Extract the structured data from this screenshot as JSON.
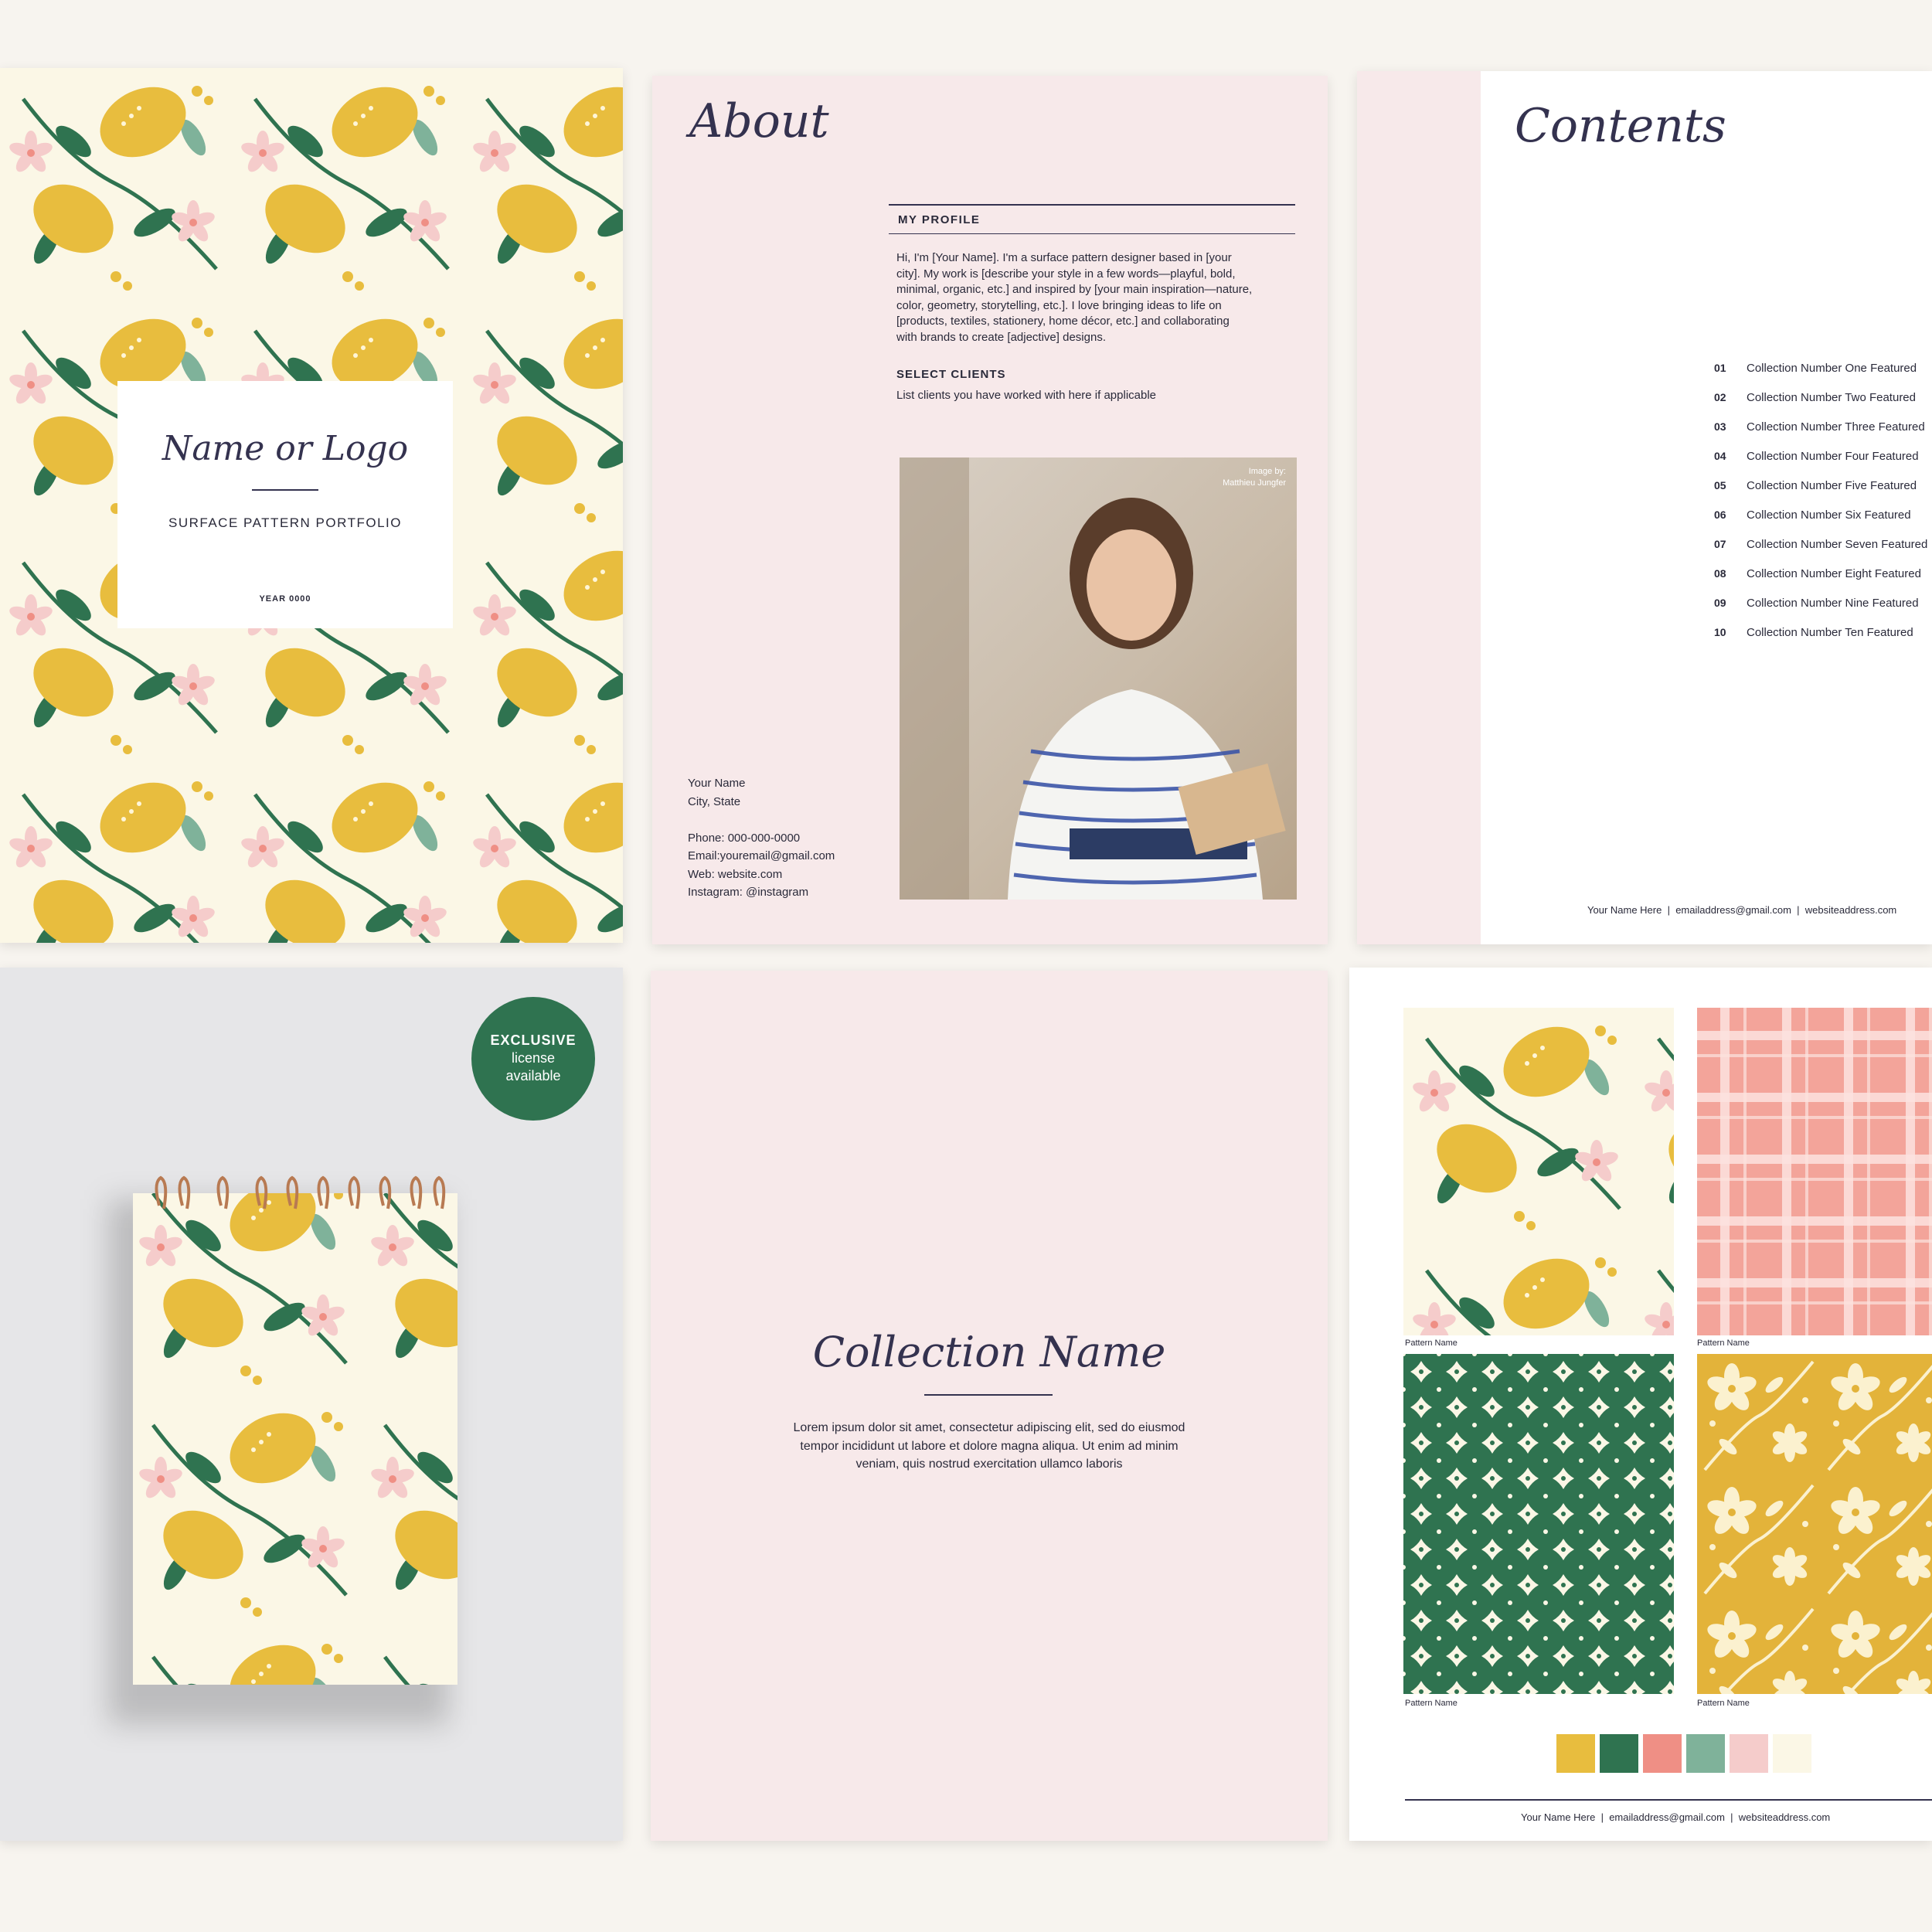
{
  "colors": {
    "background": "#f7f4ef",
    "cream": "#fbf7e6",
    "lemon": "#e8bd3e",
    "green": "#2f7350",
    "coral": "#ef8f85",
    "sage": "#7fb29a",
    "blush": "#f5cccb",
    "pink_page": "#f7e9ea",
    "navy": "#34324f"
  },
  "cover": {
    "title": "Name or Logo",
    "subtitle": "SURFACE PATTERN PORTFOLIO",
    "year": "YEAR 0000"
  },
  "about": {
    "heading": "About",
    "profile_heading": "MY PROFILE",
    "profile_lines": [
      "Hi, I'm [Your Name].  I'm a surface pattern designer based in [your",
      "city]. My work is [describe your style in a few words—playful, bold,",
      "minimal, organic, etc.] and inspired by [your main inspiration—nature,",
      "color, geometry, storytelling, etc.]. I love bringing ideas to life on",
      "[products, textiles, stationery, home décor, etc.] and collaborating",
      "with brands to create [adjective] designs."
    ],
    "clients_heading": "SELECT CLIENTS",
    "clients_text": "List clients you have worked with here if applicable",
    "image_credit_1": "Image by:",
    "image_credit_2": "Matthieu Jungfer",
    "contact": {
      "name": "Your Name",
      "city": "City, State",
      "phone": "Phone: 000-000-0000",
      "email": "Email:youremail@gmail.com",
      "web": "Web: website.com",
      "instagram": "Instagram: @instagram"
    }
  },
  "contents": {
    "heading": "Contents",
    "items": [
      {
        "num": "01",
        "label": "Collection Number One Featured"
      },
      {
        "num": "02",
        "label": "Collection Number Two Featured"
      },
      {
        "num": "03",
        "label": "Collection Number Three Featured"
      },
      {
        "num": "04",
        "label": "Collection Number Four Featured"
      },
      {
        "num": "05",
        "label": "Collection Number Five Featured"
      },
      {
        "num": "06",
        "label": "Collection Number Six Featured"
      },
      {
        "num": "07",
        "label": "Collection Number Seven Featured"
      },
      {
        "num": "08",
        "label": "Collection Number Eight Featured"
      },
      {
        "num": "09",
        "label": "Collection Number Nine Featured"
      },
      {
        "num": "10",
        "label": "Collection Number Ten Featured"
      }
    ],
    "footer": {
      "name": "Your Name Here",
      "email": "emailaddress@gmail.com",
      "web": "websiteaddress.com"
    }
  },
  "mockup": {
    "badge_line1": "EXCLUSIVE",
    "badge_line2": "license",
    "badge_line3": "available"
  },
  "collection": {
    "title": "Collection Name",
    "desc_lines": [
      "Lorem ipsum dolor sit amet, consectetur adipiscing elit, sed do eiusmod",
      "tempor incididunt ut labore et dolore magna aliqua. Ut enim ad minim",
      "veniam, quis nostrud exercitation ullamco laboris"
    ]
  },
  "patterns": {
    "tiles": [
      {
        "caption": "Pattern Name"
      },
      {
        "caption": "Pattern Name"
      },
      {
        "caption": "Pattern Name"
      },
      {
        "caption": "Pattern Name"
      }
    ],
    "swatches": [
      "#e8bd3e",
      "#2f7350",
      "#ef8f85",
      "#7fb29a",
      "#f5cccb",
      "#fbf7e6"
    ],
    "footer": {
      "name": "Your Name Here",
      "email": "emailaddress@gmail.com",
      "web": "websiteaddress.com"
    }
  }
}
